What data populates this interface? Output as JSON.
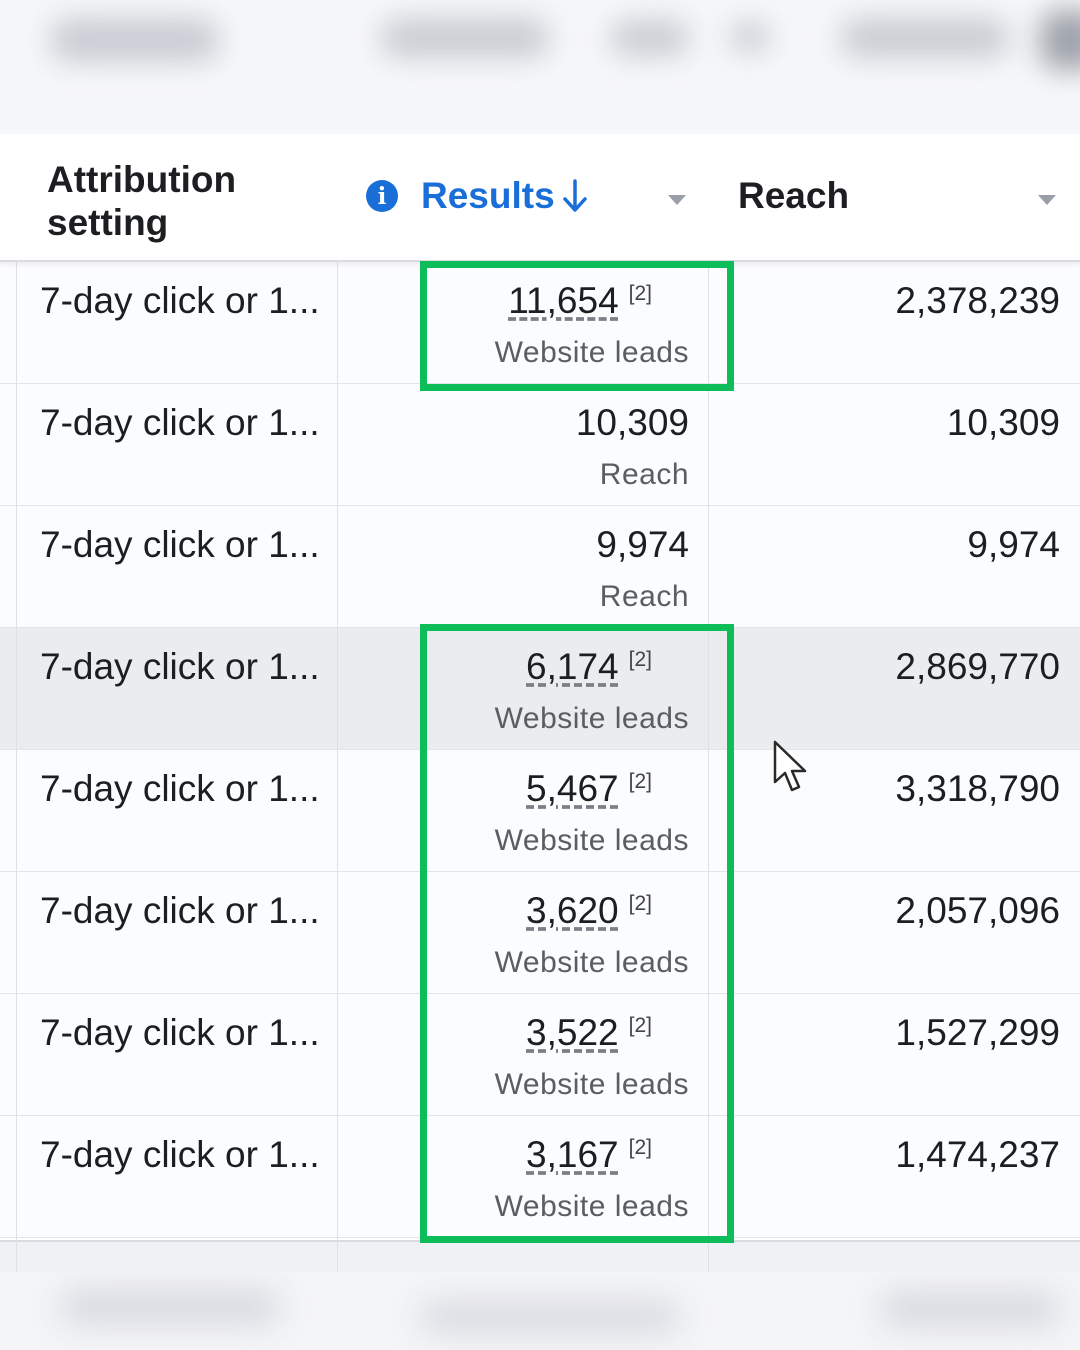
{
  "header": {
    "attribution_label": "Attribution setting",
    "results_label": "Results",
    "reach_label": "Reach",
    "info_icon": "info-icon",
    "sort_icon": "sort-down-arrow-icon"
  },
  "rows": [
    {
      "attribution": "7-day click or 1...",
      "result": "11,654",
      "footnote": "[2]",
      "result_type": "Website leads",
      "reach": "2,378,239"
    },
    {
      "attribution": "7-day click or 1...",
      "result": "10,309",
      "footnote": "",
      "result_type": "Reach",
      "reach": "10,309"
    },
    {
      "attribution": "7-day click or 1...",
      "result": "9,974",
      "footnote": "",
      "result_type": "Reach",
      "reach": "9,974"
    },
    {
      "attribution": "7-day click or 1...",
      "result": "6,174",
      "footnote": "[2]",
      "result_type": "Website leads",
      "reach": "2,869,770"
    },
    {
      "attribution": "7-day click or 1...",
      "result": "5,467",
      "footnote": "[2]",
      "result_type": "Website leads",
      "reach": "3,318,790"
    },
    {
      "attribution": "7-day click or 1...",
      "result": "3,620",
      "footnote": "[2]",
      "result_type": "Website leads",
      "reach": "2,057,096"
    },
    {
      "attribution": "7-day click or 1...",
      "result": "3,522",
      "footnote": "[2]",
      "result_type": "Website leads",
      "reach": "1,527,299"
    },
    {
      "attribution": "7-day click or 1...",
      "result": "3,167",
      "footnote": "[2]",
      "result_type": "Website leads",
      "reach": "1,474,237"
    }
  ],
  "colors": {
    "accent_blue": "#1a6ed8",
    "highlight_green": "#0dbd5a",
    "hover_row": "#ebecee"
  }
}
